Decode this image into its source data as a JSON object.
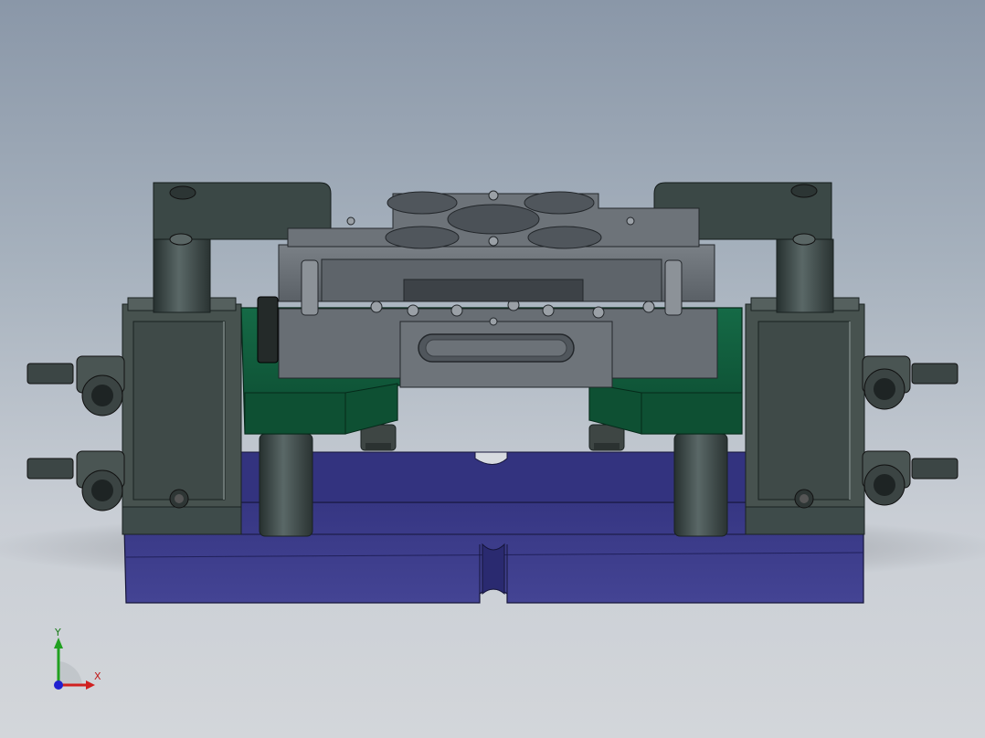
{
  "viewport": {
    "background_top": "#8a97a8",
    "background_bottom": "#d3d6da"
  },
  "model": {
    "colors": {
      "base_plate": "#3a3a8c",
      "mid_plate": "#0f5a3c",
      "steel": "#6c7278",
      "dark_steel": "#3d4a48",
      "pillar": "#3e4b4a"
    }
  },
  "triad": {
    "x_label": "X",
    "y_label": "Y",
    "x_color": "#d02020",
    "y_color": "#20a020",
    "z_color": "#2020d0"
  }
}
